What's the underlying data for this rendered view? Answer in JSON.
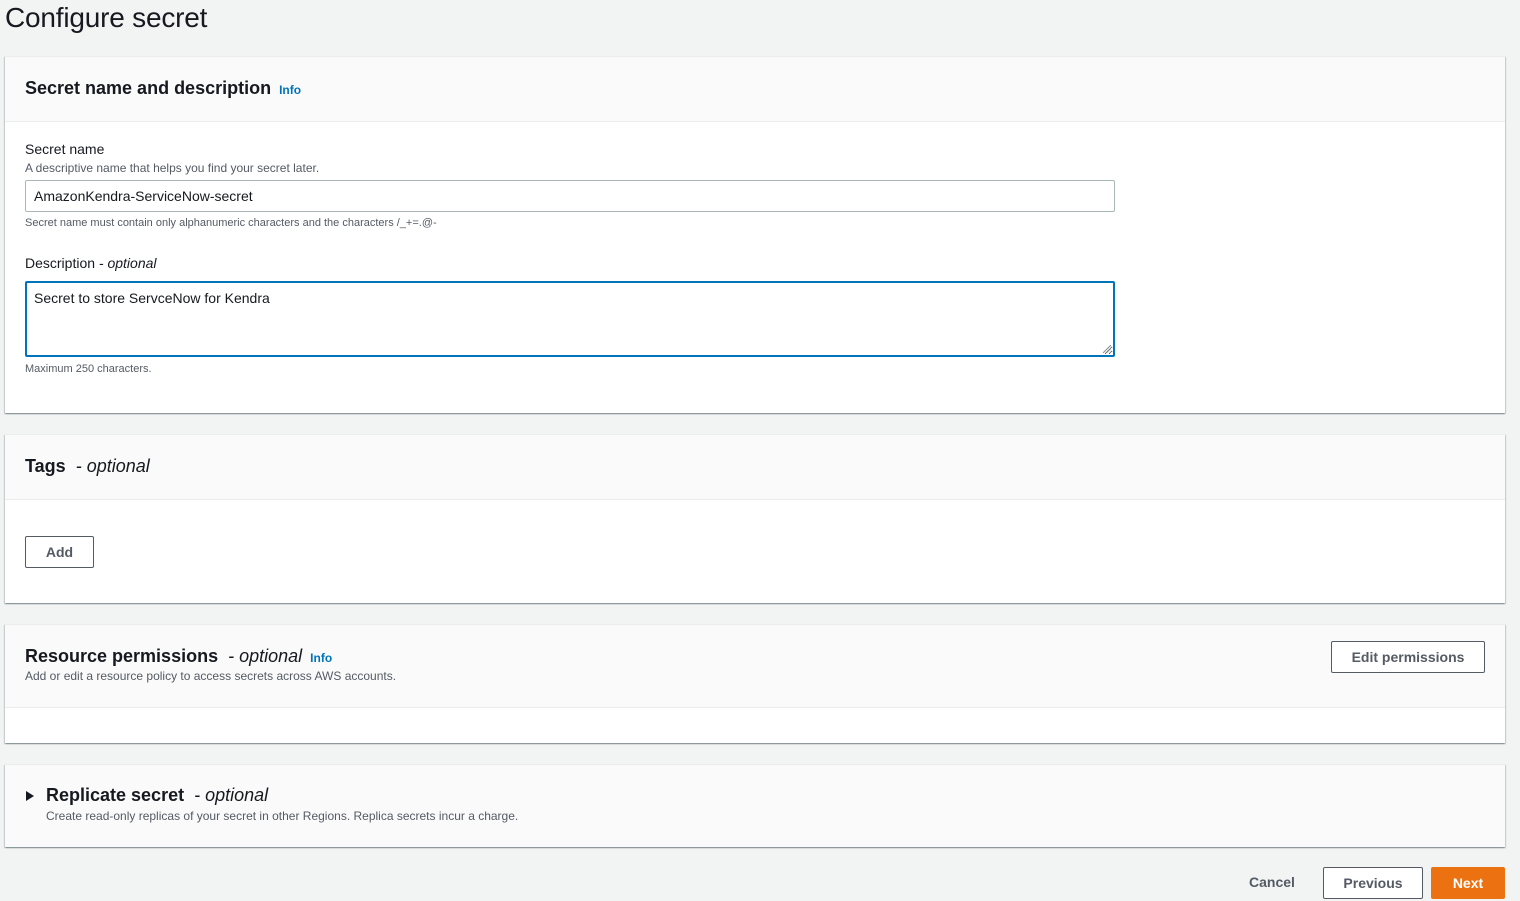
{
  "page": {
    "title": "Configure secret"
  },
  "name_section": {
    "title": "Secret name and description",
    "info": "Info",
    "secret_name": {
      "label": "Secret name",
      "description": "A descriptive name that helps you find your secret later.",
      "value": "AmazonKendra-ServiceNow-secret",
      "constraint": "Secret name must contain only alphanumeric characters and the characters /_+=.@-"
    },
    "description_field": {
      "label": "Description",
      "label_optional": "- optional",
      "value": "Secret to store ServceNow for Kendra",
      "constraint": "Maximum 250 characters."
    }
  },
  "tags_section": {
    "title": "Tags",
    "title_optional": "- optional",
    "add_label": "Add"
  },
  "permissions_section": {
    "title": "Resource permissions",
    "title_optional": "- optional",
    "info": "Info",
    "description": "Add or edit a resource policy to access secrets across AWS accounts.",
    "edit_label": "Edit permissions"
  },
  "replicate_section": {
    "title": "Replicate secret",
    "title_optional": "- optional",
    "description": "Create read-only replicas of your secret in other Regions. Replica secrets incur a charge."
  },
  "footer": {
    "cancel_label": "Cancel",
    "previous_label": "Previous",
    "next_label": "Next"
  },
  "colors": {
    "primary": "#ec7211",
    "link": "#0073bb",
    "focus_border": "#0073bb"
  }
}
